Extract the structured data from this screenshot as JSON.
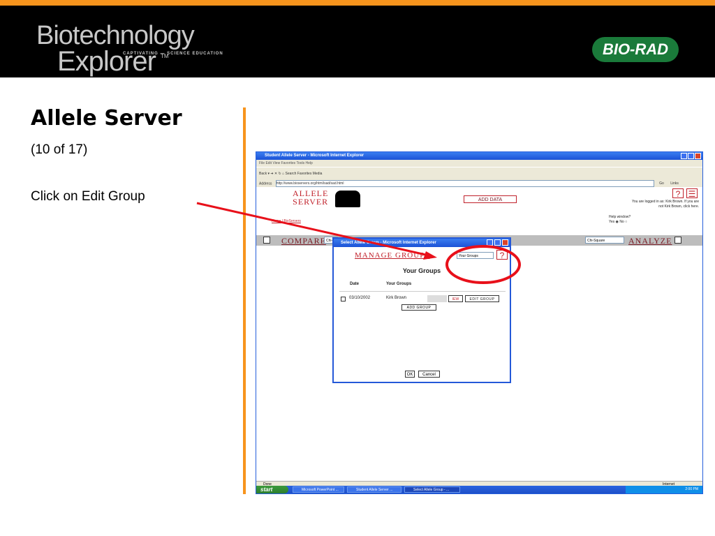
{
  "brand": {
    "line1": "Biotechnology",
    "line2": "Explorer",
    "tm": "TM",
    "tagline": "CAPTIVATING — SCIENCE EDUCATION",
    "company": "BIO-RAD",
    "orange": "#f7941d",
    "green": "#1a7a3a"
  },
  "slide": {
    "title": "Allele Server",
    "subtitle": "(10 of 17)",
    "instruction": "Click on Edit Group"
  },
  "browser": {
    "window_title": "Student Allele Server - Microsoft Internet Explorer",
    "menu": "File   Edit   View   Favorites   Tools   Help",
    "toolbar": "Back  ▾   ➔   ✕   ↻   ⌂    Search    Favorites    Media",
    "address_label": "Address",
    "address_value": "http://www.bioservers.org/html/sad/sad.html",
    "go_label": "Go",
    "links_label": "Links",
    "status": "Done",
    "zone": "Internet"
  },
  "page": {
    "logo_line1": "ALLELE",
    "logo_line2": "SERVER",
    "home_link": "Home | BioServers",
    "add_data": "ADD DATA",
    "login_line1": "You are logged in as: Kirk Brown. If you are",
    "login_line2": "not Kirk Brown, click here.",
    "help_window_label": "Help window?",
    "help_yes": "Yes",
    "help_no": "No",
    "compare": "COMPARE",
    "compare_select": "Chi-",
    "chi_select": "Chi-Square",
    "analyze": "ANALYZE"
  },
  "popup": {
    "title": "Select Allele Group - Microsoft Internet Explorer",
    "manage": "MANAGE GROUPS",
    "select_value": "Your Groups",
    "heading": "Your Groups",
    "col_date": "Date",
    "col_groups": "Your Groups",
    "row_date": "03/10/2002",
    "row_name": "Kirk Brown",
    "view_btn": "IEW",
    "edit_btn": "EDIT GROUP",
    "add_group_btn": "ADD GROUP",
    "ok_btn": "OK",
    "cancel_btn": "Cancel"
  },
  "taskbar": {
    "start": "start",
    "item1": "Microsoft PowerPoint ...",
    "item2": "Student Allele Server ...",
    "item3": "Select Allele Group - ...",
    "clock": "2:00 PM"
  },
  "annotation": {
    "arrow_color": "#e8101a",
    "circle_color": "#e8101a"
  }
}
